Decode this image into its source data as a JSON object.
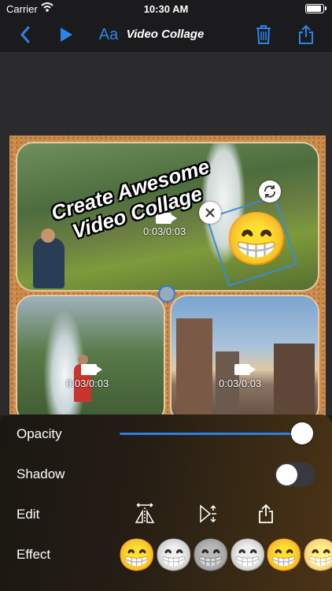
{
  "status_bar": {
    "carrier": "Carrier",
    "time": "10:30 AM"
  },
  "nav": {
    "back_icon": "chevron-left-icon",
    "play_icon": "play-icon",
    "font_label": "Aa",
    "title": "Video Collage",
    "delete_icon": "trash-icon",
    "share_icon": "share-icon",
    "accent_color": "#2d84e8"
  },
  "collage": {
    "caption_line1": "Create Awesome",
    "caption_line2": "Video Collage",
    "sticker": "😁",
    "clips": [
      {
        "duration": "0:03/0:03"
      },
      {
        "duration": "0:03/0:03"
      },
      {
        "duration": "0:03/0:03"
      }
    ]
  },
  "panel": {
    "opacity_label": "Opacity",
    "opacity_value": 1.0,
    "shadow_label": "Shadow",
    "shadow_on": false,
    "edit_label": "Edit",
    "edit_tools": [
      "flip-horizontal-icon",
      "flip-vertical-icon",
      "share-icon"
    ],
    "effect_label": "Effect",
    "effects": [
      {
        "emoji": "😁",
        "style": "color"
      },
      {
        "emoji": "😁",
        "style": "gray"
      },
      {
        "emoji": "😁",
        "style": "gray-dark"
      },
      {
        "emoji": "😁",
        "style": "gray"
      },
      {
        "emoji": "😁",
        "style": "color"
      },
      {
        "emoji": "😁",
        "style": "partial"
      }
    ]
  }
}
